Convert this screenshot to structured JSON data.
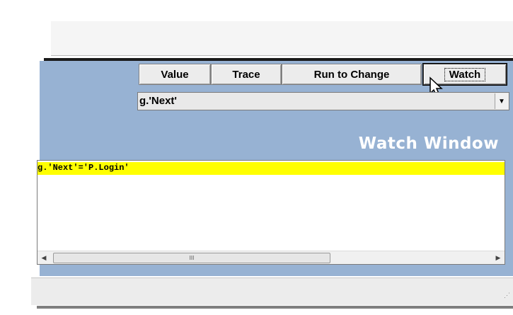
{
  "toolbar": {
    "value_label": "Value",
    "trace_label": "Trace",
    "run_label": "Run to Change",
    "watch_label": "Watch"
  },
  "expression_combo": {
    "selected": "g.'Next'"
  },
  "watch_window": {
    "title": "Watch Window",
    "rows": [
      "g.'Next'='P.Login'"
    ]
  },
  "scrollbar": {
    "thumb_grip": "III"
  }
}
